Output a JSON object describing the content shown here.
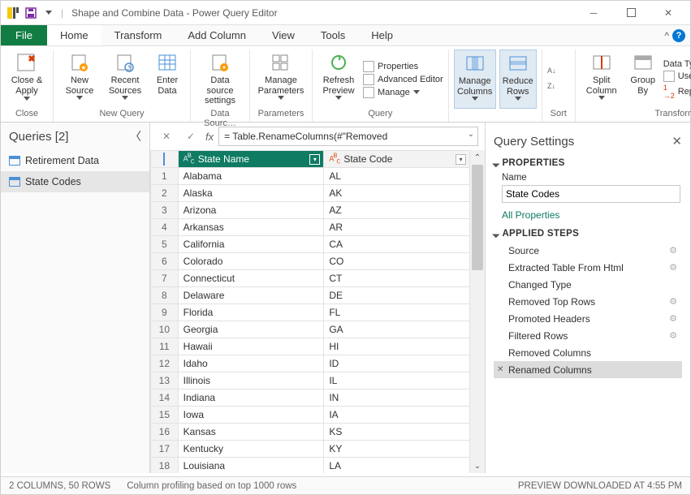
{
  "window_title": "Shape and Combine Data - Power Query Editor",
  "menus": {
    "file": "File",
    "home": "Home",
    "transform": "Transform",
    "add_column": "Add Column",
    "view": "View",
    "tools": "Tools",
    "help": "Help"
  },
  "ribbon": {
    "close_apply": "Close &\nApply",
    "close": "Close",
    "new_source": "New\nSource",
    "recent_sources": "Recent\nSources",
    "enter_data": "Enter\nData",
    "new_query": "New Query",
    "data_source_settings": "Data source\nsettings",
    "data_sources": "Data Sourc…",
    "manage_parameters": "Manage\nParameters",
    "parameters": "Parameters",
    "refresh_preview": "Refresh\nPreview",
    "properties": "Properties",
    "advanced_editor": "Advanced Editor",
    "manage": "Manage",
    "query": "Query",
    "manage_columns": "Manage\nColumns",
    "reduce_rows": "Reduce\nRows",
    "sort": "Sort",
    "split_column": "Split\nColumn",
    "group_by": "Group\nBy",
    "data_type": "Data Type: Text",
    "use_first_row": "Use First Row as Head",
    "replace_values": "Replace Values",
    "transform": "Transform"
  },
  "queries": {
    "title": "Queries [2]",
    "items": [
      "Retirement Data",
      "State Codes"
    ]
  },
  "formula": "= Table.RenameColumns(#\"Removed",
  "columns": [
    {
      "name": "State Name"
    },
    {
      "name": "State Code"
    }
  ],
  "rows": [
    {
      "n": 1,
      "a": "Alabama",
      "b": "AL"
    },
    {
      "n": 2,
      "a": "Alaska",
      "b": "AK"
    },
    {
      "n": 3,
      "a": "Arizona",
      "b": "AZ"
    },
    {
      "n": 4,
      "a": "Arkansas",
      "b": "AR"
    },
    {
      "n": 5,
      "a": "California",
      "b": "CA"
    },
    {
      "n": 6,
      "a": "Colorado",
      "b": "CO"
    },
    {
      "n": 7,
      "a": "Connecticut",
      "b": "CT"
    },
    {
      "n": 8,
      "a": "Delaware",
      "b": "DE"
    },
    {
      "n": 9,
      "a": "Florida",
      "b": "FL"
    },
    {
      "n": 10,
      "a": "Georgia",
      "b": "GA"
    },
    {
      "n": 11,
      "a": "Hawaii",
      "b": "HI"
    },
    {
      "n": 12,
      "a": "Idaho",
      "b": "ID"
    },
    {
      "n": 13,
      "a": "Illinois",
      "b": "IL"
    },
    {
      "n": 14,
      "a": "Indiana",
      "b": "IN"
    },
    {
      "n": 15,
      "a": "Iowa",
      "b": "IA"
    },
    {
      "n": 16,
      "a": "Kansas",
      "b": "KS"
    },
    {
      "n": 17,
      "a": "Kentucky",
      "b": "KY"
    },
    {
      "n": 18,
      "a": "Louisiana",
      "b": "LA"
    }
  ],
  "settings": {
    "title": "Query Settings",
    "properties": "PROPERTIES",
    "name_label": "Name",
    "name_value": "State Codes",
    "all_properties": "All Properties",
    "applied_steps": "APPLIED STEPS",
    "steps": [
      {
        "label": "Source",
        "gear": true
      },
      {
        "label": "Extracted Table From Html",
        "gear": true
      },
      {
        "label": "Changed Type",
        "gear": false
      },
      {
        "label": "Removed Top Rows",
        "gear": true
      },
      {
        "label": "Promoted Headers",
        "gear": true
      },
      {
        "label": "Filtered Rows",
        "gear": true
      },
      {
        "label": "Removed Columns",
        "gear": false
      },
      {
        "label": "Renamed Columns",
        "gear": false
      }
    ]
  },
  "status": {
    "left": "2 COLUMNS, 50 ROWS",
    "mid": "Column profiling based on top 1000 rows",
    "right": "PREVIEW DOWNLOADED AT 4:55 PM"
  }
}
